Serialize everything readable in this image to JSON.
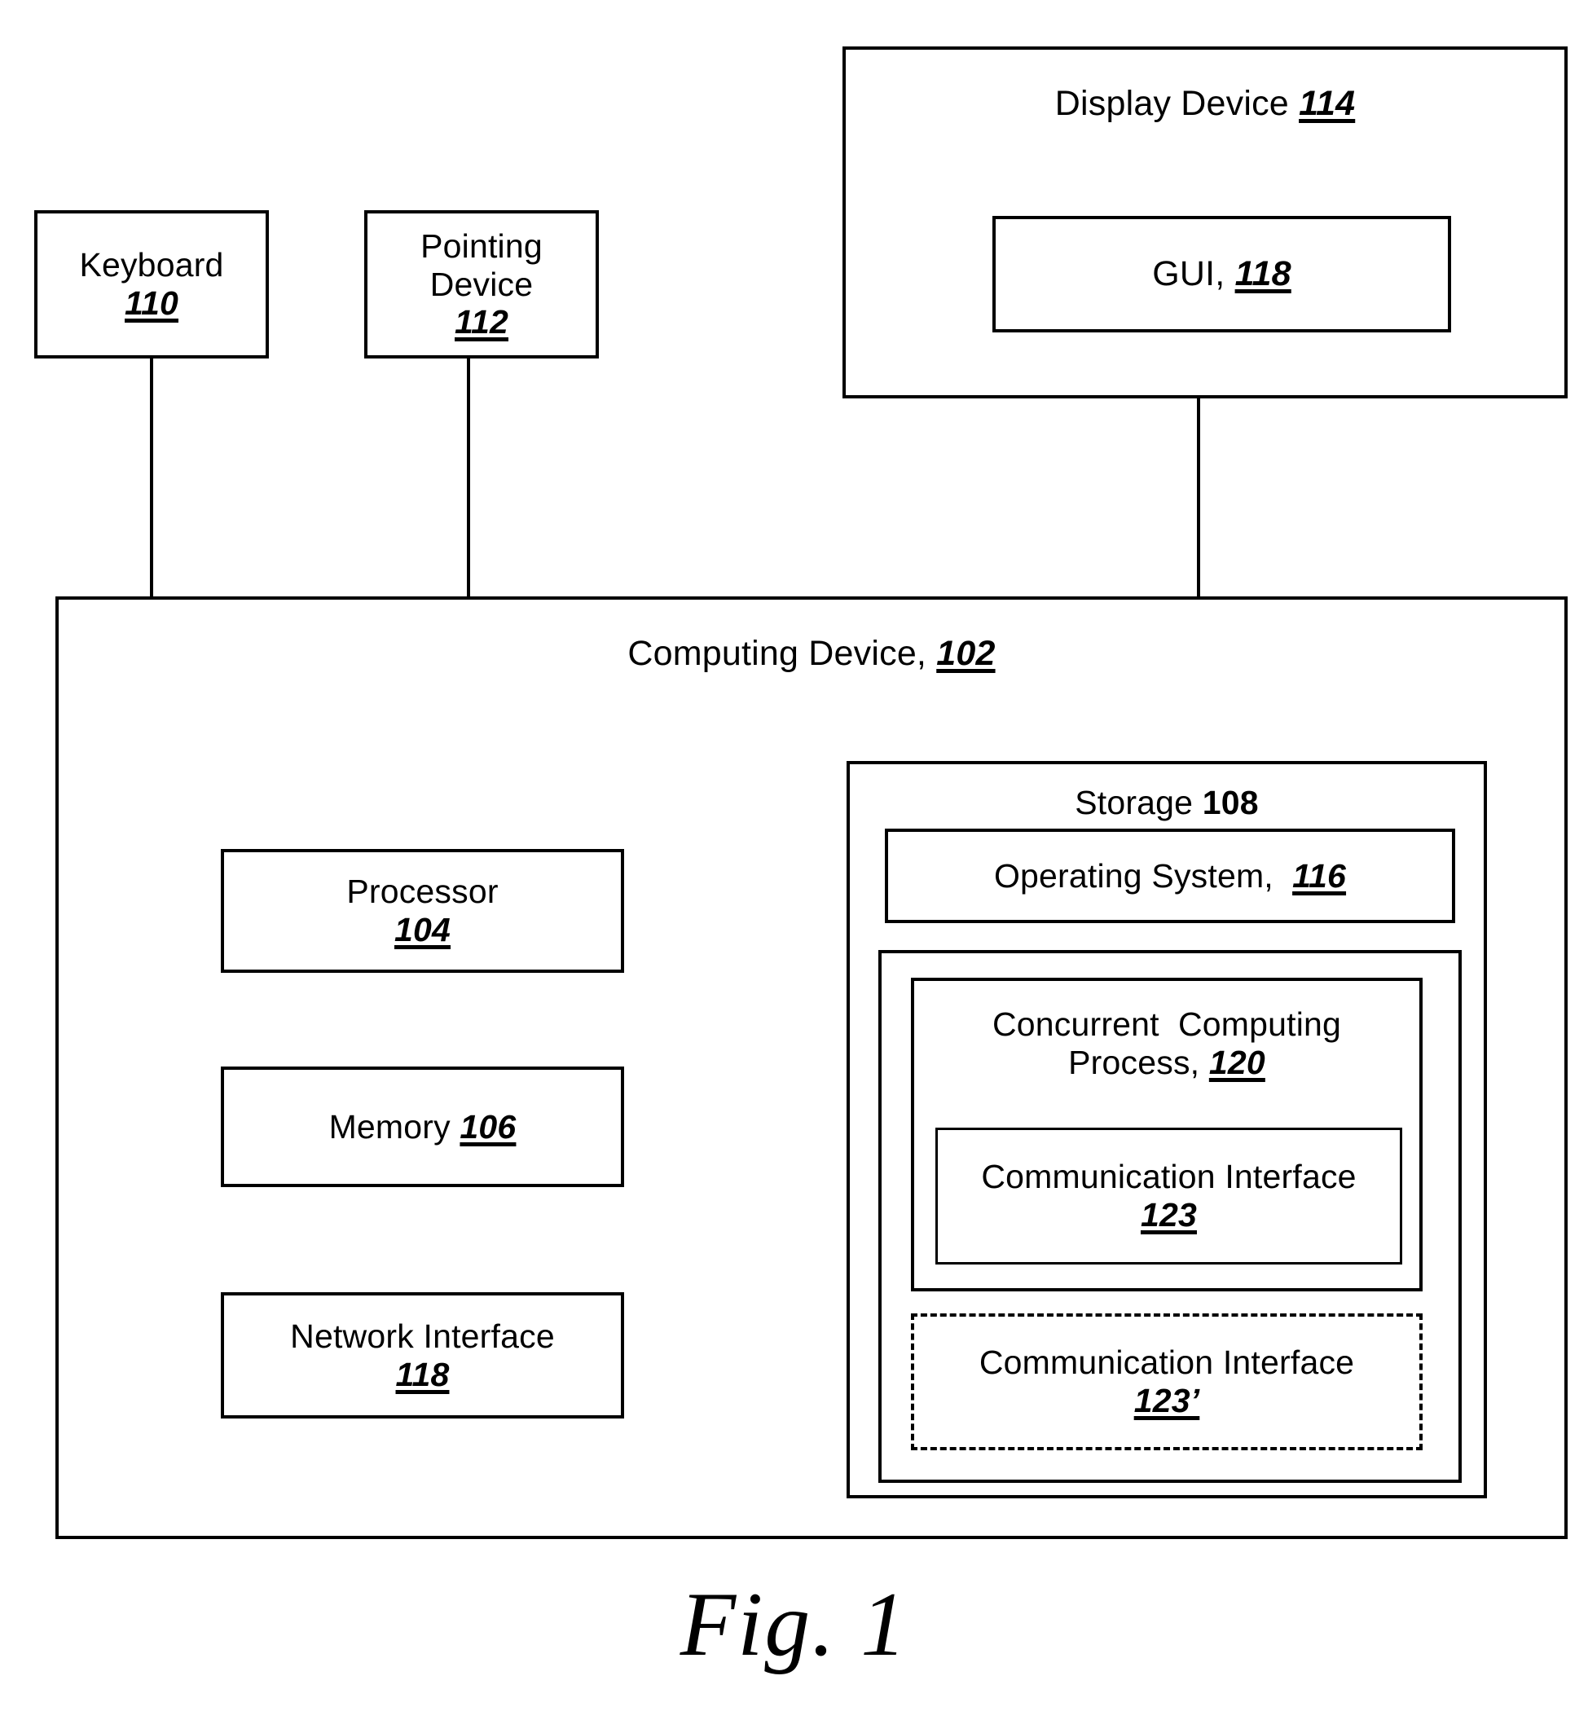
{
  "figure": {
    "caption": "Fig. 1",
    "type": "patent-block-diagram"
  },
  "blocks": {
    "keyboard": {
      "name": "Keyboard",
      "ref": "110"
    },
    "pointing_device": {
      "name_line1": "Pointing",
      "name_line2": "Device",
      "ref": "112"
    },
    "display_device": {
      "name": "Display Device ",
      "ref": "114",
      "gui": {
        "name": "GUI, ",
        "ref": "118"
      }
    },
    "computing_device": {
      "name": "Computing Device, ",
      "ref": "102",
      "processor": {
        "name": "Processor",
        "ref": "104"
      },
      "memory": {
        "name": "Memory ",
        "ref": "106"
      },
      "network_interface": {
        "name": "Network Interface",
        "ref": "118"
      },
      "storage": {
        "name": "Storage ",
        "ref": "108",
        "operating_system": {
          "name": "Operating System,  ",
          "ref": "116"
        },
        "concurrent_computing_process": {
          "name_line1": "Concurrent  Computing",
          "name_line2": "Process, ",
          "ref": "120",
          "communication_interface": {
            "name": "Communication Interface",
            "ref": "123"
          }
        },
        "communication_interface_alt": {
          "name": "Communication Interface",
          "ref": "123’",
          "border_style": "dashed"
        }
      }
    }
  },
  "connectors": [
    {
      "from": "keyboard",
      "to": "computing_device"
    },
    {
      "from": "pointing_device",
      "to": "computing_device"
    },
    {
      "from": "display_device",
      "to": "computing_device"
    }
  ],
  "colors": {
    "line": "#000000",
    "background": "#ffffff",
    "text": "#000000"
  }
}
